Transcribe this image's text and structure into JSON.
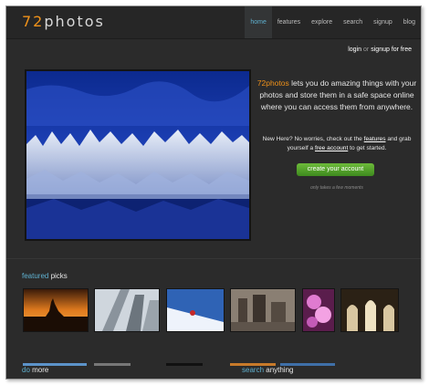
{
  "brand": {
    "logo_number": "72",
    "logo_word": "photos"
  },
  "nav": {
    "items": [
      "home",
      "features",
      "explore",
      "search",
      "signup",
      "blog"
    ],
    "active": "home"
  },
  "auth": {
    "login": "login",
    "or": "or",
    "signup": "signup for free"
  },
  "hero": {
    "brand": "72photos",
    "intro_text": " lets you do amazing things with your photos and store them in a safe space online where you can access them from anywhere.",
    "sub_pre": "New Here? No worries, check out the ",
    "sub_link1": "features",
    "sub_mid": " and grab yourself a ",
    "sub_link2": "free account",
    "sub_post": " to get started.",
    "cta": "create your account",
    "note": "only takes a few moments"
  },
  "featured": {
    "accent": "featured",
    "rest": " picks"
  },
  "footer": {
    "left_accent": "do",
    "left_rest": " more",
    "right_accent": "search",
    "right_rest": " anything"
  },
  "colors": {
    "accent_orange": "#f0921a",
    "accent_blue": "#5fb0cf",
    "cta_green": "#4f9e2a",
    "background": "#2b2b2b"
  }
}
